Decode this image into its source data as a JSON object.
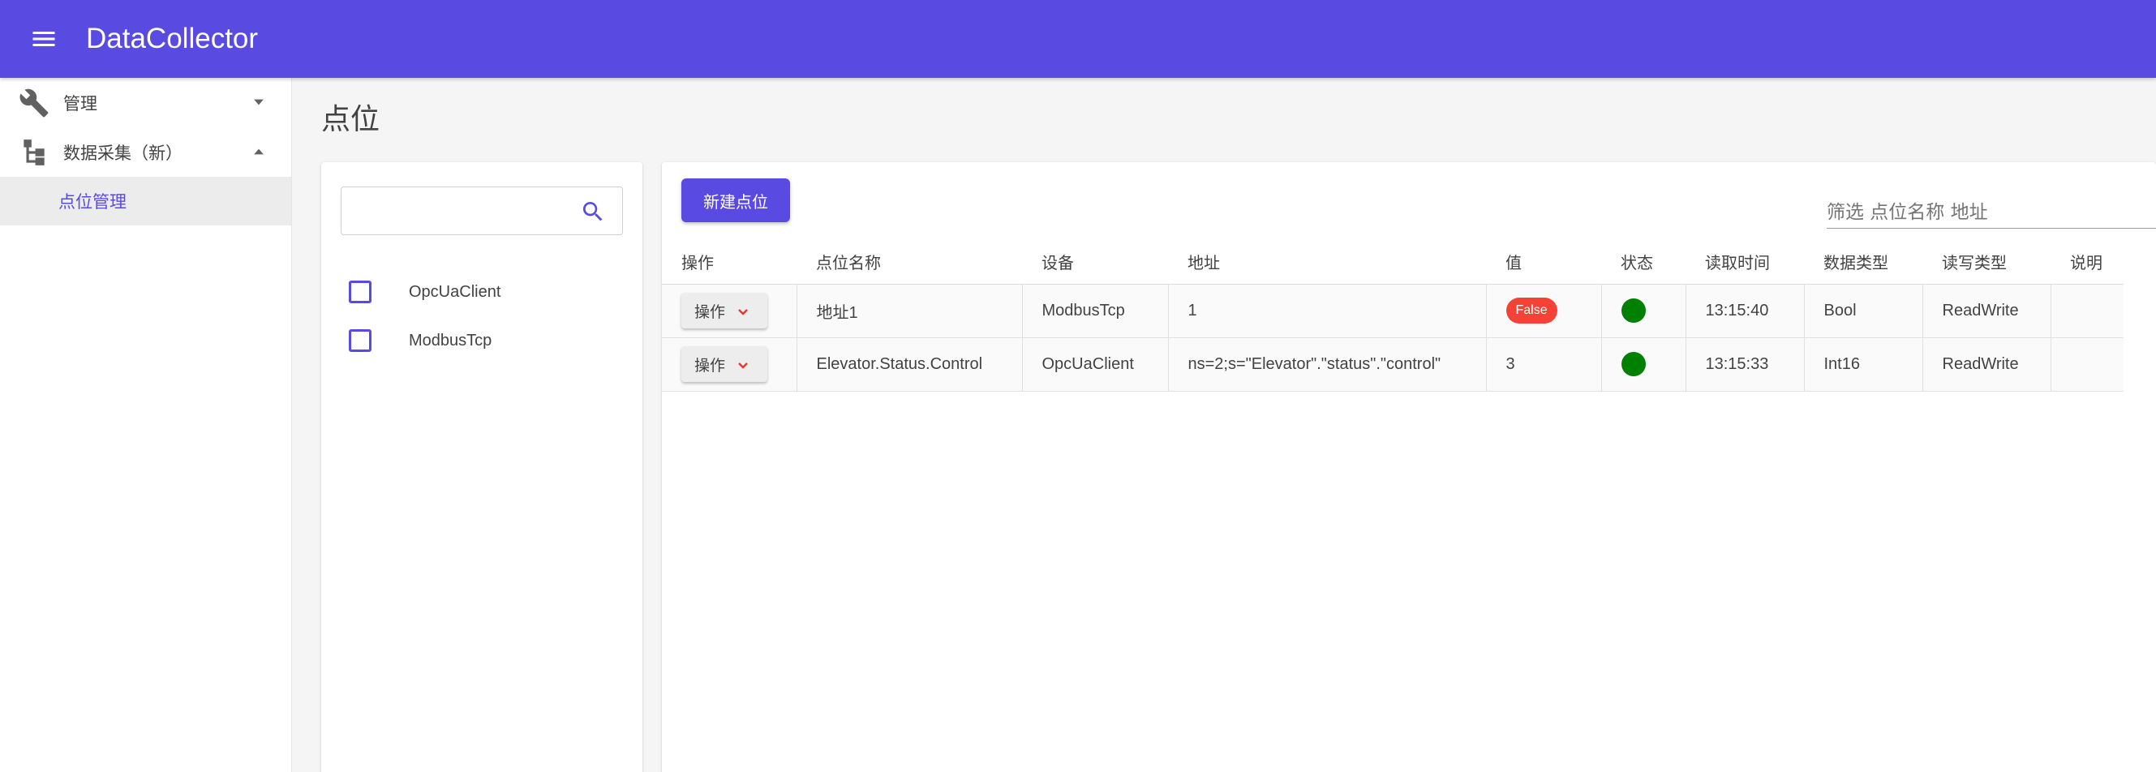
{
  "app": {
    "title": "DataCollector"
  },
  "sidebar": {
    "groups": [
      {
        "label": "管理",
        "icon": "wrench-icon",
        "expanded": false
      },
      {
        "label": "数据采集（新）",
        "icon": "hierarchy-icon",
        "expanded": true
      }
    ],
    "active_item": {
      "label": "点位管理"
    }
  },
  "page": {
    "title": "点位"
  },
  "device_filter": {
    "search_placeholder": "",
    "devices": [
      {
        "label": "OpcUaClient",
        "checked": false
      },
      {
        "label": "ModbusTcp",
        "checked": false
      }
    ]
  },
  "toolbar": {
    "new_label": "新建点位",
    "filter_placeholder": "筛选 点位名称 地址"
  },
  "table": {
    "columns": [
      "操作",
      "点位名称",
      "设备",
      "地址",
      "值",
      "状态",
      "读取时间",
      "数据类型",
      "读写类型",
      "说明"
    ],
    "rows": [
      {
        "action": "操作",
        "name": "地址1",
        "device": "ModbusTcp",
        "address": "1",
        "value": "False",
        "value_is_badge": true,
        "status": "online",
        "read_time": "13:15:40",
        "data_type": "Bool",
        "rw_type": "ReadWrite",
        "description": ""
      },
      {
        "action": "操作",
        "name": "Elevator.Status.Control",
        "device": "OpcUaClient",
        "address": "ns=2;s=\"Elevator\".\"status\".\"control\"",
        "value": "3",
        "value_is_badge": false,
        "status": "online",
        "read_time": "13:15:33",
        "data_type": "Int16",
        "rw_type": "ReadWrite",
        "description": ""
      }
    ]
  },
  "colors": {
    "primary": "#594ae2",
    "badge_false": "#f44336",
    "status_online": "#008000"
  }
}
